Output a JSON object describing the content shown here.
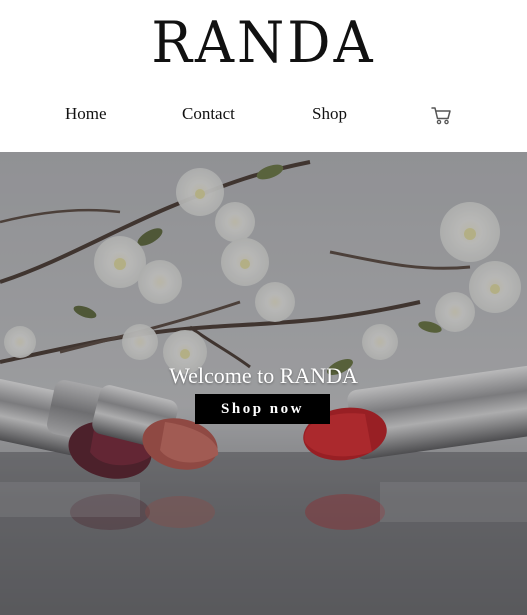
{
  "brand": {
    "logo_text": "RANDA"
  },
  "nav": {
    "items": [
      {
        "label": "Home"
      },
      {
        "label": "Contact"
      },
      {
        "label": "Shop"
      }
    ],
    "cart_icon": "cart-icon"
  },
  "hero": {
    "title": "Welcome to RANDA",
    "button_label": "Shop now",
    "image": "lipsticks-with-white-blossoms"
  },
  "colors": {
    "background": "#ffffff",
    "text": "#111111",
    "button_bg": "#000000",
    "button_text": "#ffffff",
    "hero_text": "#ffffff"
  }
}
